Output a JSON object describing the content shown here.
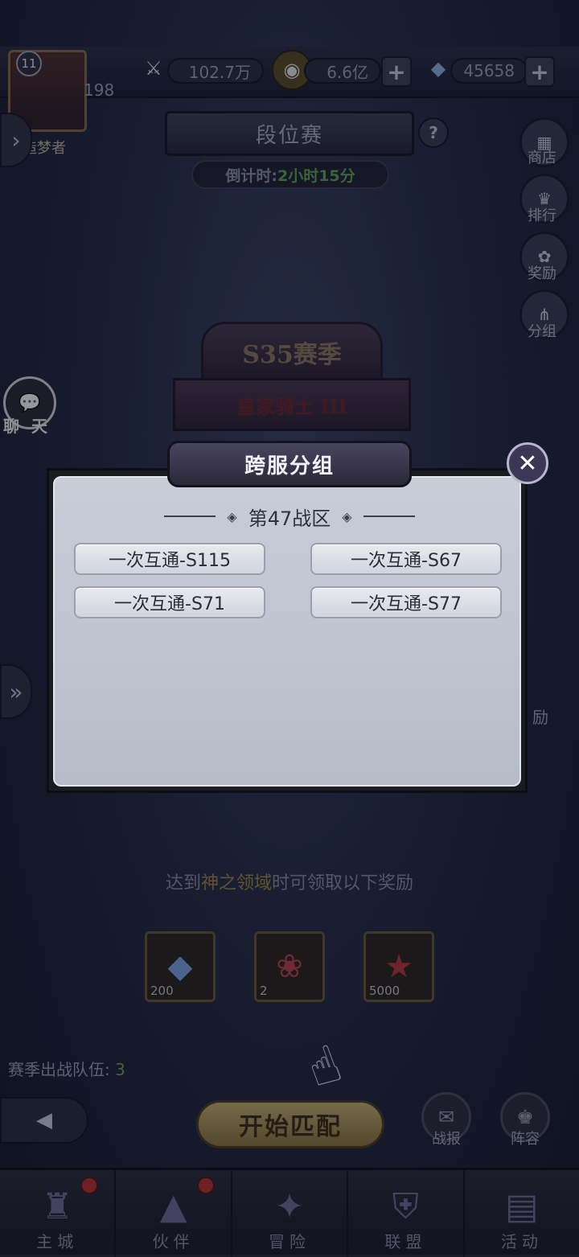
{
  "top_bar": {
    "power": "102.7万",
    "gold": "6.6亿",
    "diamonds": "45658",
    "player_level": "11",
    "exp_value": "198",
    "player_title": "造梦者"
  },
  "header": {
    "title": "段位赛",
    "countdown_label": "倒计时:",
    "countdown_value": "2小时15分"
  },
  "side_menu": [
    "商店",
    "排行",
    "奖励",
    "分组"
  ],
  "season": {
    "name": "S35赛季",
    "rank": "皇家骑士 III"
  },
  "chat_label": "聊 天",
  "modal": {
    "title": "跨服分组",
    "zone_title": "第47战区",
    "servers": [
      "一次互通-S115",
      "一次互通-S67",
      "一次互通-S71",
      "一次互通-S77"
    ]
  },
  "rewards": {
    "caption_pre": "达到",
    "caption_highlight": "神之领域",
    "caption_post": "时可领取以下奖励",
    "items": [
      {
        "icon": "diamond-icon",
        "count": "200"
      },
      {
        "icon": "rose-icon",
        "count": "2"
      },
      {
        "icon": "star-medal-icon",
        "count": "5000"
      }
    ]
  },
  "team": {
    "label": "赛季出战队伍:",
    "count": "3"
  },
  "actions": {
    "start_match": "开始匹配",
    "battle_report": "战报",
    "lineup": "阵容"
  },
  "partial_right_label": "励",
  "nav": [
    "主城",
    "伙伴",
    "冒险",
    "联盟",
    "活动"
  ]
}
